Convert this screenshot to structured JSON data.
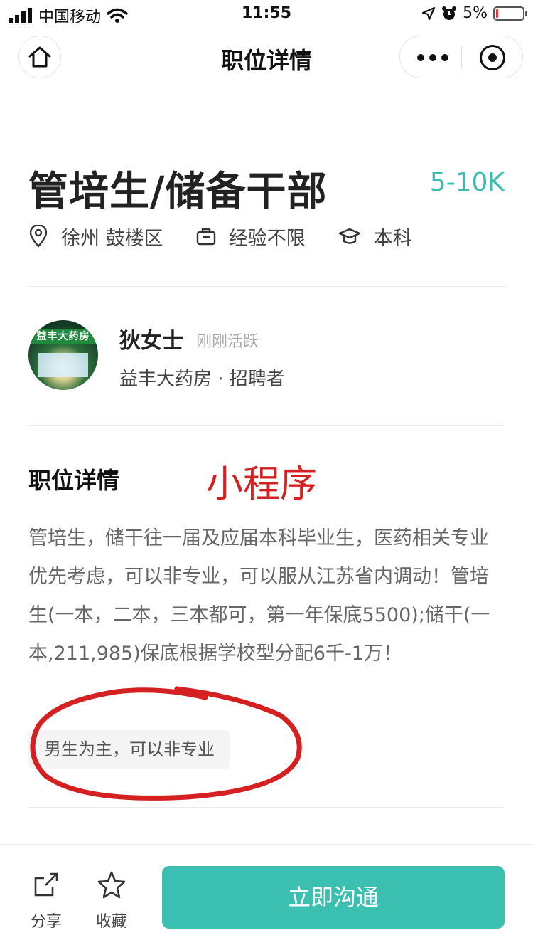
{
  "status_bar": {
    "carrier": "中国移动",
    "time": "11:55",
    "battery": "5%",
    "battery_level": 0.05
  },
  "nav": {
    "title": "职位详情"
  },
  "job": {
    "title": "管培生/储备干部",
    "salary": "5-10K",
    "location": "徐州 鼓楼区",
    "experience": "经验不限",
    "education": "本科"
  },
  "recruiter": {
    "name": "狄女士",
    "active": "刚刚活跃",
    "company": "益丰大药房 · 招聘者",
    "avatar_sign": "益丰大药房"
  },
  "details": {
    "section_title": "职位详情",
    "annotation": "小程序",
    "description": "管培生，储干往一届及应届本科毕业生，医药相关专业优先考虑，可以非专业，可以服从江苏省内调动！管培生(一本，二本，三本都可，第一年保底5500);储干(一本,211,985)保底根据学校型分配6千-1万！",
    "tag": "男生为主，可以非专业"
  },
  "bottom_bar": {
    "share_label": "分享",
    "favorite_label": "收藏",
    "cta_label": "立即沟通"
  },
  "colors": {
    "accent": "#3bbfb1",
    "salary": "#3cbcb0",
    "annotation_red": "#d42020"
  },
  "icons": {
    "home": "home-icon",
    "more": "more-dots-icon",
    "close": "target-icon",
    "location": "location-pin-icon",
    "experience": "briefcase-icon",
    "education": "graduation-cap-icon",
    "share": "share-icon",
    "favorite": "star-icon"
  }
}
